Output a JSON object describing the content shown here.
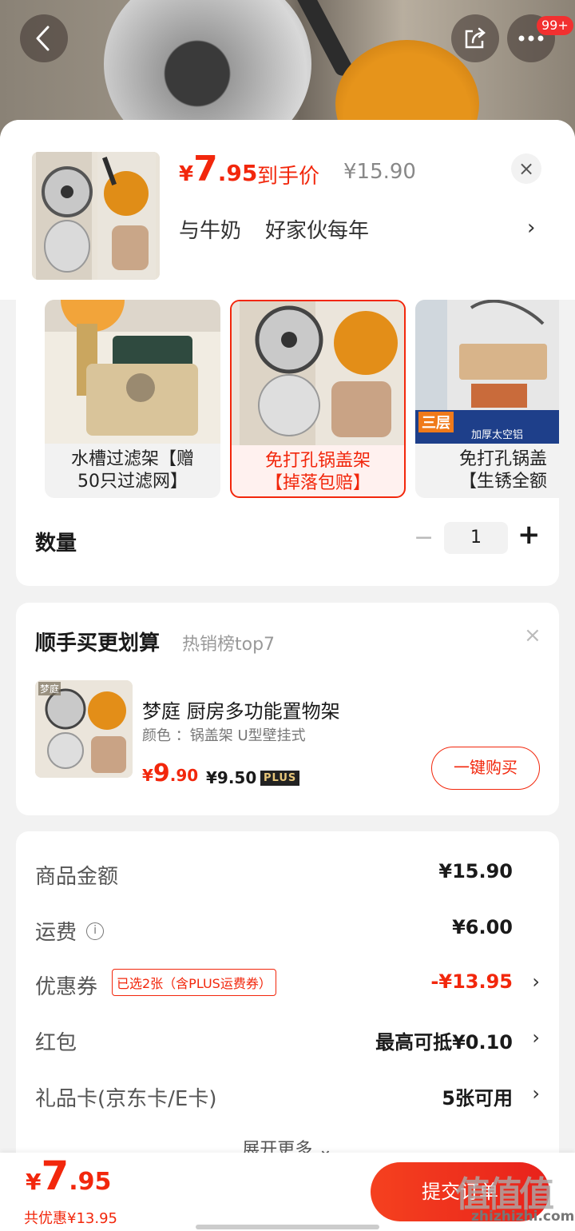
{
  "header": {
    "badge": "99+"
  },
  "product": {
    "price_symbol": "¥",
    "price_int": "7",
    "price_dec": ".95",
    "price_label": "到手价",
    "original_price": "¥15.90",
    "spec_a": "与牛奶",
    "spec_b": "好家伙每年",
    "arrow": "›",
    "close": "×"
  },
  "variants": [
    {
      "line1": "水槽过滤架【赠",
      "line2": "50只过滤网】",
      "selected": false
    },
    {
      "line1": "免打孔锅盖架",
      "line2": "【掉落包赔】",
      "selected": true
    },
    {
      "line1": "免打孔锅盖",
      "line2": "【生锈全额",
      "selected": false
    }
  ],
  "variant_overlay": {
    "tag3": "三层",
    "tag3_note": "加厚太空铝"
  },
  "quantity": {
    "label": "数量",
    "minus": "−",
    "value": "1",
    "plus": "+"
  },
  "upsell": {
    "title": "顺手买更划算",
    "subtitle": "热销榜top7",
    "close": "×",
    "name": "梦庭  厨房多功能置物架",
    "spec": "颜色 ：锅盖架  U型壁挂式",
    "price_symbol": "¥",
    "price_int": "9",
    "price_dec": ".90",
    "plus_price": "¥9.50",
    "plus_tag": "PLUS",
    "buy_button": "一键购买",
    "img_tag": "梦庭"
  },
  "summary": {
    "rows": [
      {
        "label": "商品金额",
        "value": "¥15.90"
      },
      {
        "label": "运费",
        "value": "¥6.00",
        "info": "i"
      },
      {
        "label": "优惠券",
        "value": "-¥13.95",
        "tag": "已选2张（含PLUS运费券）",
        "arrow": "›"
      },
      {
        "label": "红包",
        "value": "最高可抵¥0.10",
        "arrow": "›"
      },
      {
        "label": "礼品卡(京东卡/E卡)",
        "value": "5张可用",
        "arrow": "›"
      }
    ],
    "expand": "展开更多 ⌄"
  },
  "bottom": {
    "price_symbol": "¥",
    "price_int": "7",
    "price_dec": ".95",
    "savings": "共优惠¥13.95",
    "submit": "提交订单"
  },
  "watermark": {
    "logo": "值值值",
    "text": "zhizhizhi.com"
  },
  "colors": {
    "accent": "#f2270c",
    "background": "#f2f2f2"
  }
}
